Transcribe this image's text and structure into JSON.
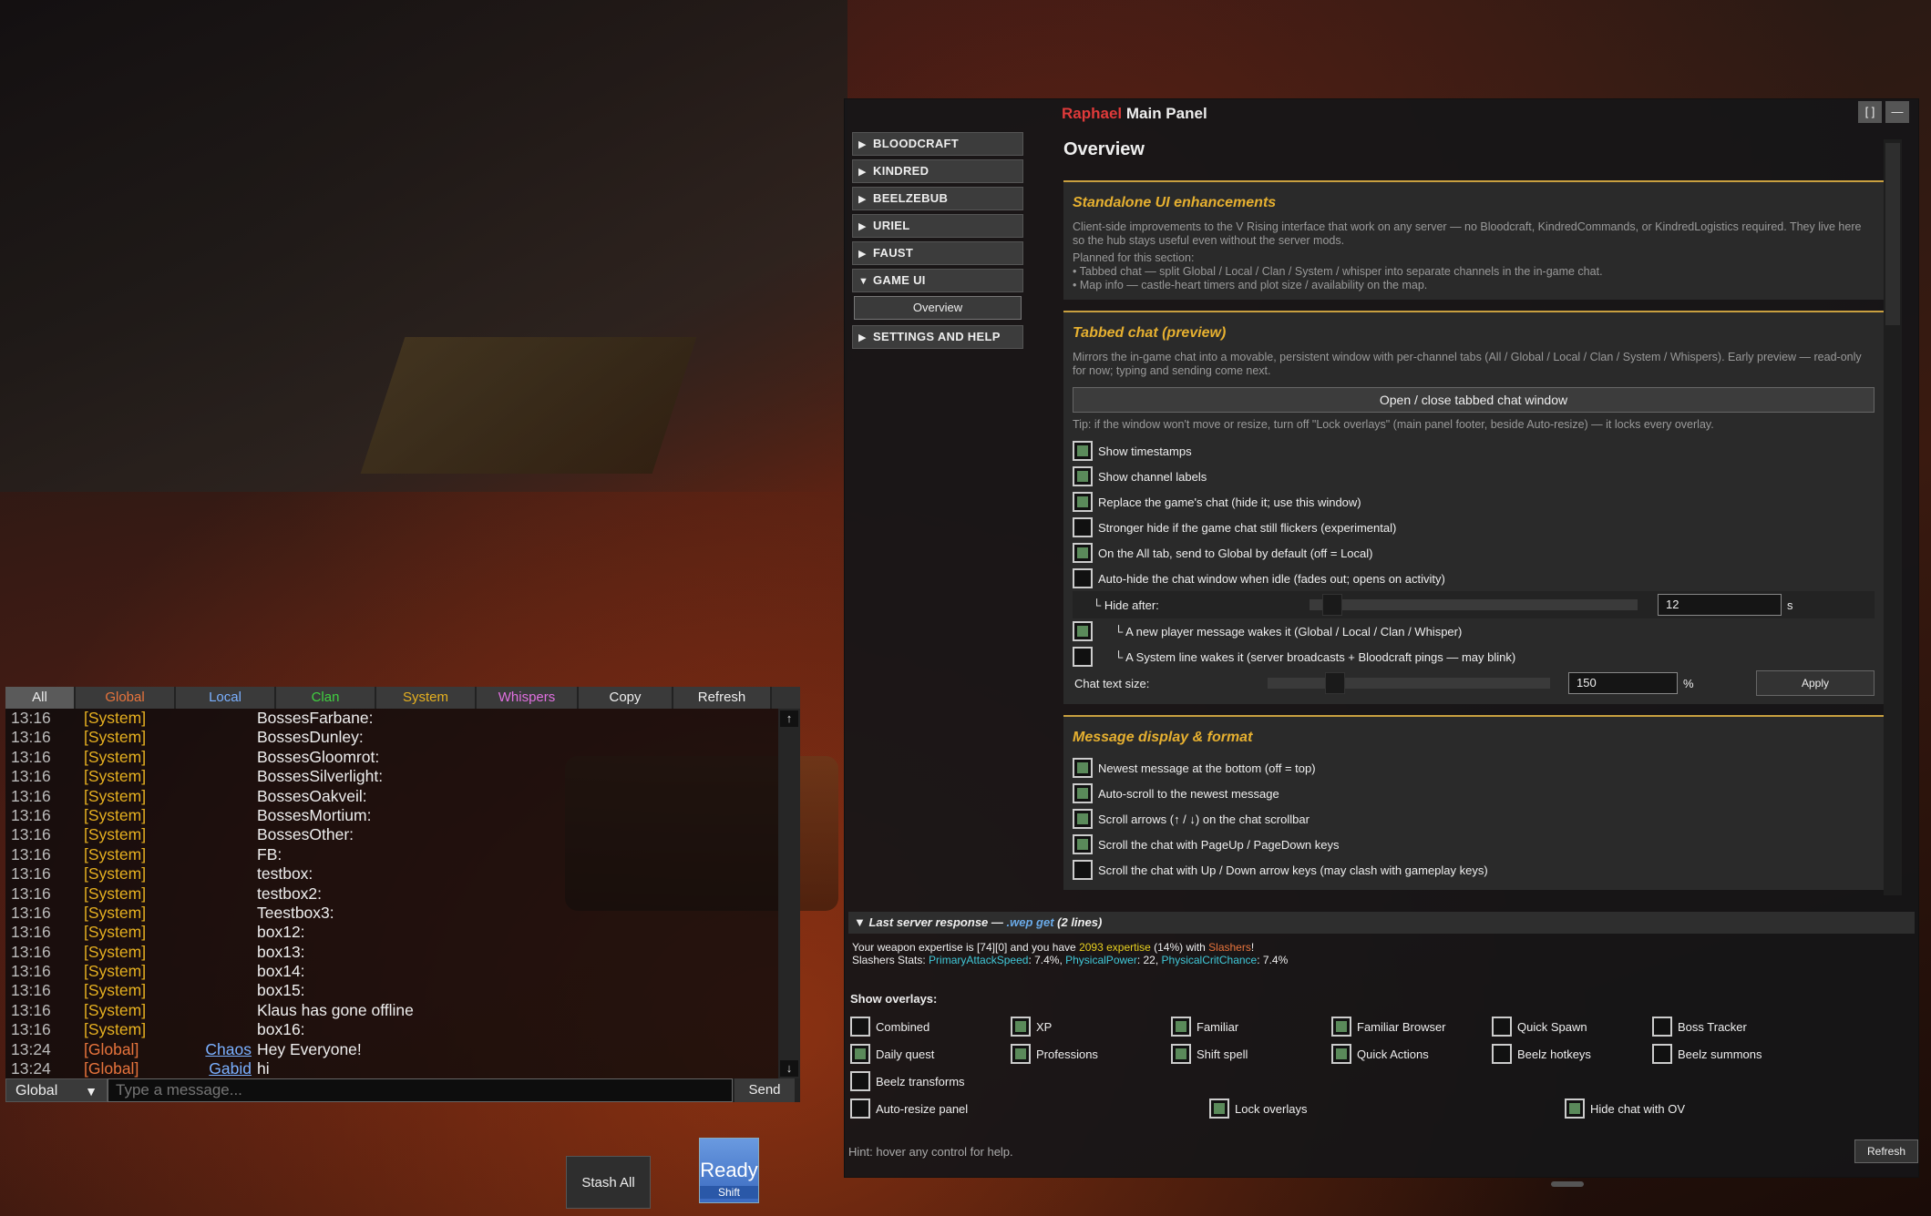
{
  "chat": {
    "tabs": [
      {
        "label": "All",
        "color": "#eeeeee",
        "active": true
      },
      {
        "label": "Global",
        "color": "#e8743c"
      },
      {
        "label": "Local",
        "color": "#7ab0ff"
      },
      {
        "label": "Clan",
        "color": "#40d040"
      },
      {
        "label": "System",
        "color": "#e6b020"
      },
      {
        "label": "Whispers",
        "color": "#e070e0"
      },
      {
        "label": "Copy",
        "color": "#eeeeee"
      },
      {
        "label": "Refresh",
        "color": "#eeeeee"
      }
    ],
    "messages": [
      {
        "time": "13:16",
        "channel": "[System]",
        "sender": "",
        "text": "BossesFarbane:"
      },
      {
        "time": "13:16",
        "channel": "[System]",
        "sender": "",
        "text": "BossesDunley:"
      },
      {
        "time": "13:16",
        "channel": "[System]",
        "sender": "",
        "text": "BossesGloomrot:"
      },
      {
        "time": "13:16",
        "channel": "[System]",
        "sender": "",
        "text": "BossesSilverlight:"
      },
      {
        "time": "13:16",
        "channel": "[System]",
        "sender": "",
        "text": "BossesOakveil:"
      },
      {
        "time": "13:16",
        "channel": "[System]",
        "sender": "",
        "text": "BossesMortium:"
      },
      {
        "time": "13:16",
        "channel": "[System]",
        "sender": "",
        "text": "BossesOther:"
      },
      {
        "time": "13:16",
        "channel": "[System]",
        "sender": "",
        "text": "FB:"
      },
      {
        "time": "13:16",
        "channel": "[System]",
        "sender": "",
        "text": "testbox:"
      },
      {
        "time": "13:16",
        "channel": "[System]",
        "sender": "",
        "text": "testbox2:"
      },
      {
        "time": "13:16",
        "channel": "[System]",
        "sender": "",
        "text": "Teestbox3:"
      },
      {
        "time": "13:16",
        "channel": "[System]",
        "sender": "",
        "text": "box12:"
      },
      {
        "time": "13:16",
        "channel": "[System]",
        "sender": "",
        "text": "box13:"
      },
      {
        "time": "13:16",
        "channel": "[System]",
        "sender": "",
        "text": "box14:"
      },
      {
        "time": "13:16",
        "channel": "[System]",
        "sender": "",
        "text": "box15:"
      },
      {
        "time": "13:16",
        "channel": "[System]",
        "sender": "",
        "text": "Klaus has gone offline"
      },
      {
        "time": "13:16",
        "channel": "[System]",
        "sender": "",
        "text": "box16:"
      },
      {
        "time": "13:24",
        "channel": "[Global]",
        "sender": "Chaos",
        "text": "Hey Everyone!"
      },
      {
        "time": "13:24",
        "channel": "[Global]",
        "sender": "Gabid",
        "text": "hi"
      }
    ],
    "channel_select": "Global",
    "input_placeholder": "Type a message...",
    "send_label": "Send",
    "scroll_up": "↑",
    "scroll_down": "↓"
  },
  "hotbar": {
    "stash_label": "Stash All",
    "ready_label": "Ready",
    "ready_key": "Shift"
  },
  "panel": {
    "title_name": "Raphael",
    "title_rest": " Main Panel",
    "maximize_label": "[ ]",
    "minimize_label": "—",
    "sidebar": [
      {
        "label": "BLOODCRAFT",
        "expanded": false
      },
      {
        "label": "KINDRED",
        "expanded": false
      },
      {
        "label": "BEELZEBUB",
        "expanded": false
      },
      {
        "label": "URIEL",
        "expanded": false
      },
      {
        "label": "FAUST",
        "expanded": false
      },
      {
        "label": "GAME UI",
        "expanded": true
      }
    ],
    "sidebar_sub": "Overview",
    "sidebar_last": "SETTINGS AND HELP",
    "heading": "Overview",
    "standalone": {
      "title": "Standalone UI enhancements",
      "desc": "Client-side improvements to the V Rising interface that work on any server — no Bloodcraft, KindredCommands, or KindredLogistics required. They live here so the hub stays useful even without the server mods.",
      "planned": "Planned for this section:",
      "bullet1": "• Tabbed chat — split Global / Local / Clan / System / whisper into separate channels in the in-game chat.",
      "bullet2": "• Map info — castle-heart timers and plot size / availability on the map."
    },
    "tabbed": {
      "title": "Tabbed chat (preview)",
      "desc": "Mirrors the in-game chat into a movable, persistent window with per-channel tabs (All / Global / Local / Clan / System / Whispers). Early preview — read-only for now; typing and sending come next.",
      "open_btn": "Open / close tabbed chat window",
      "tip": "Tip: if the window won't move or resize, turn off \"Lock overlays\" (main panel footer, beside Auto-resize) — it locks every overlay.",
      "options": [
        {
          "label": "Show timestamps",
          "on": true
        },
        {
          "label": "Show channel labels",
          "on": true
        },
        {
          "label": "Replace the game's chat (hide it; use this window)",
          "on": true
        },
        {
          "label": "Stronger hide if the game chat still flickers (experimental)",
          "on": false
        },
        {
          "label": "On the All tab, send to Global by default (off = Local)",
          "on": true
        },
        {
          "label": "Auto-hide the chat window when idle (fades out; opens on activity)",
          "on": false
        }
      ],
      "hide_after_label": "└ Hide after:",
      "hide_after_value": "12",
      "hide_after_unit": "s",
      "hide_after_fraction": 0.04,
      "wake_options": [
        {
          "label": "└ A new player message wakes it (Global / Local / Clan / Whisper)",
          "on": true
        },
        {
          "label": "└ A System line wakes it (server broadcasts + Bloodcraft pings — may blink)",
          "on": false
        }
      ],
      "text_size_label": "Chat text size:",
      "text_size_value": "150",
      "text_size_unit": "%",
      "text_size_fraction": 0.22,
      "apply_label": "Apply"
    },
    "display": {
      "title": "Message display & format",
      "options": [
        {
          "label": "Newest message at the bottom (off = top)",
          "on": true
        },
        {
          "label": "Auto-scroll to the newest message",
          "on": true
        },
        {
          "label": "Scroll arrows (↑ / ↓) on the chat scrollbar",
          "on": true
        },
        {
          "label": "Scroll the chat with PageUp / PageDown keys",
          "on": true
        },
        {
          "label": "Scroll the chat with Up / Down arrow keys (may clash with gameplay keys)",
          "on": false
        }
      ]
    },
    "server": {
      "prefix": "Last server response — ",
      "command": ".wep get",
      "suffix": " (2 lines)",
      "l1a": "Your weapon expertise is [74][0] and you have ",
      "l1b": "2093 expertise",
      "l1c": " (14%) with ",
      "l1d": "Slashers",
      "l1e": "!",
      "l2a": "Slashers Stats: ",
      "l2b": "PrimaryAttackSpeed",
      "l2c": ": 7.4%, ",
      "l2d": "PhysicalPower",
      "l2e": ": 22, ",
      "l2f": "PhysicalCritChance",
      "l2g": ": 7.4%"
    },
    "overlays_label": "Show overlays:",
    "overlays": [
      {
        "label": "Combined",
        "on": false
      },
      {
        "label": "XP",
        "on": true
      },
      {
        "label": "Familiar",
        "on": true
      },
      {
        "label": "Familiar Browser",
        "on": true
      },
      {
        "label": "Quick Spawn",
        "on": false
      },
      {
        "label": "Boss Tracker",
        "on": false
      },
      {
        "label": "Daily quest",
        "on": true
      },
      {
        "label": "Professions",
        "on": true
      },
      {
        "label": "Shift spell",
        "on": true
      },
      {
        "label": "Quick Actions",
        "on": true
      },
      {
        "label": "Beelz hotkeys",
        "on": false
      },
      {
        "label": "Beelz summons",
        "on": false
      },
      {
        "label": "Beelz transforms",
        "on": false
      }
    ],
    "footer_options": [
      {
        "label": "Auto-resize panel",
        "on": false
      },
      {
        "label": "Lock overlays",
        "on": true
      },
      {
        "label": "Hide chat with OV",
        "on": true
      }
    ],
    "hint": "Hint: hover any control for help.",
    "refresh_label": "Refresh"
  }
}
